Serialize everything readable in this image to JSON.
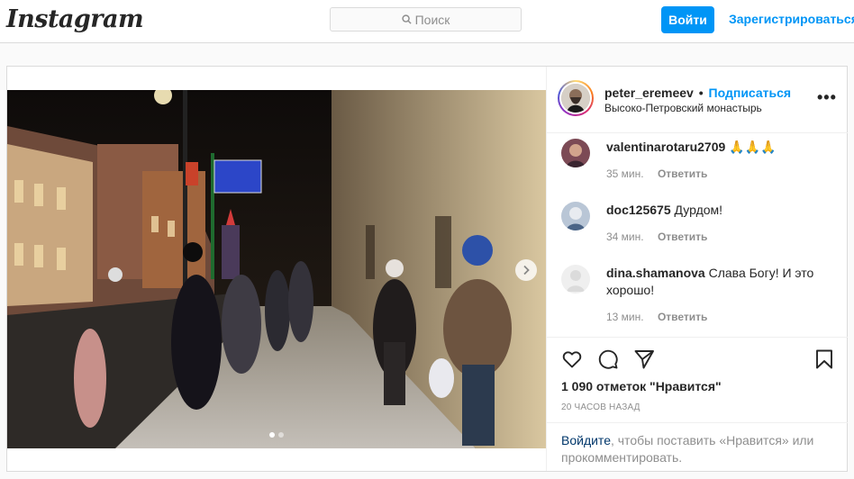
{
  "header": {
    "logo": "Instagram",
    "search_placeholder": "Поиск",
    "login_label": "Войти",
    "signup_label": "Зарегистрироваться"
  },
  "post": {
    "username": "peter_eremeev",
    "separator": "•",
    "follow_label": "Подписаться",
    "location": "Высоко-Петровский монастырь",
    "more_label": "•••",
    "carousel_total": 2,
    "carousel_active": 1,
    "likes": "1 090 отметок \"Нравится\"",
    "time_ago": "20 ЧАСОВ НАЗАД",
    "comments": [
      {
        "user": "valentinarotaru2709",
        "text": "🙏🙏🙏",
        "time": "35 мин.",
        "reply": "Ответить"
      },
      {
        "user": "doc125675",
        "text": "Дурдом!",
        "time": "34 мин.",
        "reply": "Ответить"
      },
      {
        "user": "dina.shamanova",
        "text": "Слава Богу! И это хорошо!",
        "time": "13 мин.",
        "reply": "Ответить"
      }
    ],
    "login_prompt": {
      "link": "Войдите",
      "rest": ", чтобы поставить «Нравится» или прокомментировать."
    }
  },
  "icons": {
    "search": "search-icon",
    "next": "chevron-right-icon",
    "like": "heart-icon",
    "comment": "comment-icon",
    "share": "share-icon",
    "save": "bookmark-icon"
  },
  "colors": {
    "accent": "#0095f6",
    "border": "#dbdbdb",
    "muted": "#8e8e8e"
  }
}
